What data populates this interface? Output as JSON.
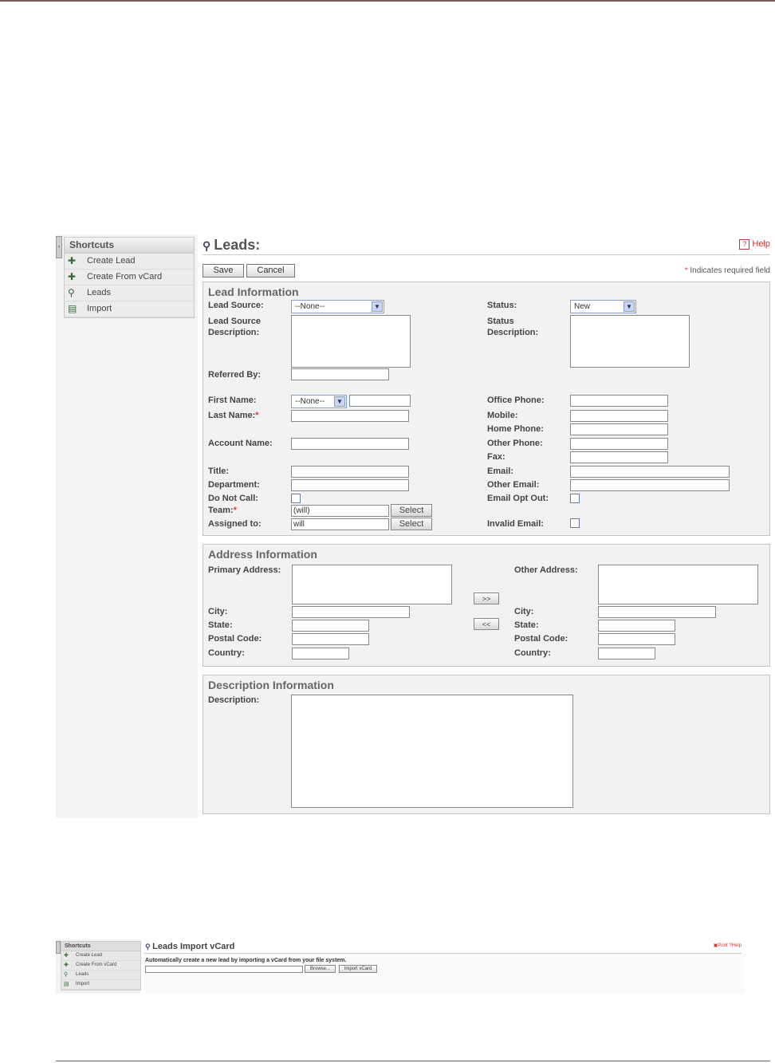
{
  "leads_form": {
    "sidebar": {
      "heading": "Shortcuts",
      "items": [
        {
          "label": "Create Lead",
          "icon": "create-lead-icon"
        },
        {
          "label": "Create From vCard",
          "icon": "create-vcard-icon"
        },
        {
          "label": "Leads",
          "icon": "leads-icon"
        },
        {
          "label": "Import",
          "icon": "import-icon"
        }
      ]
    },
    "title": "Leads:",
    "help": "Help",
    "buttons": {
      "save": "Save",
      "cancel": "Cancel"
    },
    "required_note": "Indicates required field",
    "lead_info": {
      "title": "Lead Information",
      "lead_source_label": "Lead Source:",
      "lead_source_value": "--None--",
      "lead_source_desc_label": "Lead Source Description:",
      "status_label": "Status:",
      "status_value": "New",
      "status_desc_label": "Status Description:",
      "referred_by_label": "Referred By:",
      "first_name_label": "First Name:",
      "salutation_value": "--None--",
      "last_name_label": "Last Name:",
      "account_name_label": "Account Name:",
      "title_label": "Title:",
      "department_label": "Department:",
      "do_not_call_label": "Do Not Call:",
      "team_label": "Team:",
      "team_value": "(will)",
      "assigned_to_label": "Assigned to:",
      "assigned_to_value": "will",
      "select_label": "Select",
      "office_phone_label": "Office Phone:",
      "mobile_label": "Mobile:",
      "home_phone_label": "Home Phone:",
      "other_phone_label": "Other Phone:",
      "fax_label": "Fax:",
      "email_label": "Email:",
      "other_email_label": "Other Email:",
      "email_opt_out_label": "Email Opt Out:",
      "invalid_email_label": "Invalid Email:"
    },
    "address_info": {
      "title": "Address Information",
      "primary_address_label": "Primary Address:",
      "other_address_label": "Other Address:",
      "city_label": "City:",
      "state_label": "State:",
      "postal_code_label": "Postal Code:",
      "country_label": "Country:",
      "copy_right": ">>",
      "copy_left": "<<"
    },
    "description_info": {
      "title": "Description Information",
      "description_label": "Description:"
    }
  },
  "import_vcard": {
    "sidebar": {
      "heading": "Shortcuts",
      "items": [
        "Create Lead",
        "Create From vCard",
        "Leads",
        "Import"
      ]
    },
    "title": "Leads Import vCard",
    "print": "Print",
    "help": "Help",
    "description": "Automatically create a new lead by importing a vCard from your file system.",
    "browse_label": "Browse...",
    "import_label": "Import vCard"
  }
}
